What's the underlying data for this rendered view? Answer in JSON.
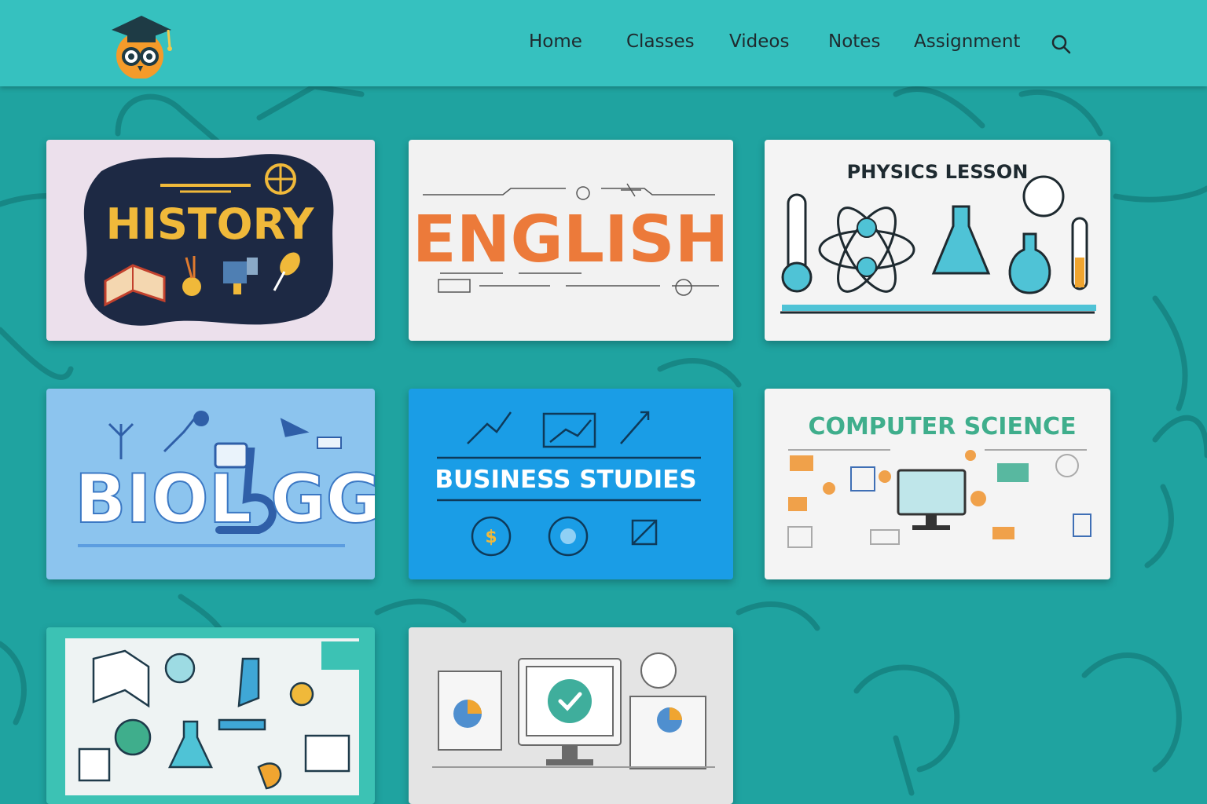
{
  "nav": {
    "items": [
      {
        "label": "Home"
      },
      {
        "label": "Classes"
      },
      {
        "label": "Videos"
      },
      {
        "label": "Notes"
      },
      {
        "label": "Assignment"
      }
    ],
    "search_icon": "search-icon",
    "logo_icon": "owl-graduation-cap-logo"
  },
  "colors": {
    "navbar": "#36c1bf",
    "background": "#1fa3a0",
    "history_title": "#f0b93a",
    "physics_accent": "#4fc3d6",
    "computer_science_title": "#3fae8c",
    "business_bg": "#1a9de6"
  },
  "cards": [
    {
      "id": "history",
      "title": "HISTORY"
    },
    {
      "id": "english",
      "title": "ENGLISH"
    },
    {
      "id": "physics",
      "title": "PHYSICS LESSON"
    },
    {
      "id": "biology",
      "title_left": "BIOL",
      "title_right": "GG"
    },
    {
      "id": "business",
      "title": "BUSINESS STUDIES"
    },
    {
      "id": "computer-science",
      "title": "COMPUTER SCIENCE"
    },
    {
      "id": "science-collage",
      "title": ""
    },
    {
      "id": "online-quiz",
      "title": ""
    }
  ]
}
